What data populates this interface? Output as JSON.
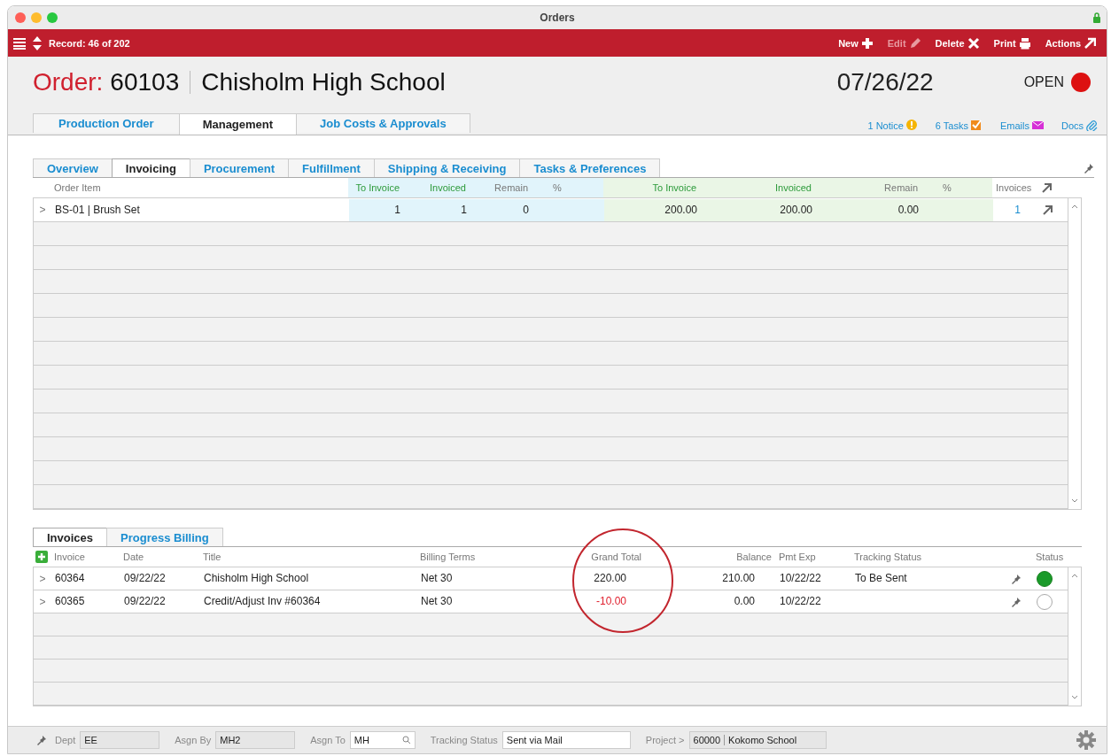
{
  "window": {
    "title": "Orders"
  },
  "toolbar": {
    "record": "Record: 46 of 202",
    "actions": [
      {
        "label": "New",
        "disabled": false
      },
      {
        "label": "Edit",
        "disabled": true
      },
      {
        "label": "Delete",
        "disabled": false
      },
      {
        "label": "Print",
        "disabled": false
      },
      {
        "label": "Actions",
        "disabled": false
      }
    ]
  },
  "header": {
    "order_label": "Order:",
    "order_number": "60103",
    "customer": "Chisholm High School",
    "date": "07/26/22",
    "status": "OPEN"
  },
  "main_tabs": [
    {
      "label": "Production Order",
      "selected": false
    },
    {
      "label": "Management",
      "selected": true
    },
    {
      "label": "Job Costs & Approvals",
      "selected": false
    }
  ],
  "links": [
    {
      "label": "1 Notice"
    },
    {
      "label": "6 Tasks"
    },
    {
      "label": "Emails"
    },
    {
      "label": "Docs"
    }
  ],
  "sub_tabs": [
    {
      "label": "Overview",
      "selected": false
    },
    {
      "label": "Invoicing",
      "selected": true
    },
    {
      "label": "Procurement",
      "selected": false
    },
    {
      "label": "Fulfillment",
      "selected": false
    },
    {
      "label": "Shipping & Receiving",
      "selected": false
    },
    {
      "label": "Tasks & Preferences",
      "selected": false
    }
  ],
  "items_table": {
    "columns": [
      "Order Item",
      "To Invoice",
      "Invoiced",
      "Remain",
      "%",
      "To Invoice",
      "Invoiced",
      "Remain",
      "%",
      "Invoices"
    ],
    "rows": [
      {
        "expander": ">",
        "cells": [
          "BS-01 | Brush Set",
          "1",
          "1",
          "0",
          "",
          "200.00",
          "200.00",
          "0.00",
          "",
          "1"
        ]
      }
    ]
  },
  "invoice_tabs": [
    {
      "label": "Invoices",
      "selected": true
    },
    {
      "label": "Progress Billing",
      "selected": false
    }
  ],
  "invoices_table": {
    "columns": [
      "Invoice",
      "Date",
      "Title",
      "Billing Terms",
      "Grand Total",
      "Balance",
      "Pmt Exp",
      "Tracking Status",
      "Status"
    ],
    "rows": [
      {
        "expander": ">",
        "invoice": "60364",
        "date": "09/22/22",
        "title": "Chisholm High School",
        "terms": "Net 30",
        "grand_total": "220.00",
        "negative": false,
        "balance": "210.00",
        "pmt_exp": "10/22/22",
        "tracking": "To Be Sent",
        "status_filled": true
      },
      {
        "expander": ">",
        "invoice": "60365",
        "date": "09/22/22",
        "title": "Credit/Adjust Inv #60364",
        "terms": "Net 30",
        "grand_total": "-10.00",
        "negative": true,
        "balance": "0.00",
        "pmt_exp": "10/22/22",
        "tracking": "",
        "status_filled": false
      }
    ]
  },
  "footer": {
    "fields": [
      {
        "label": "Dept",
        "value": "EE",
        "kind": "plain"
      },
      {
        "label": "Asgn By",
        "value": "MH2",
        "kind": "plain"
      },
      {
        "label": "Asgn To",
        "value": "MH",
        "kind": "search"
      },
      {
        "label": "Tracking Status",
        "value": "Sent via Mail",
        "kind": "white"
      }
    ],
    "project": {
      "label": "Project >",
      "number": "60000",
      "name": "Kokomo School"
    }
  }
}
